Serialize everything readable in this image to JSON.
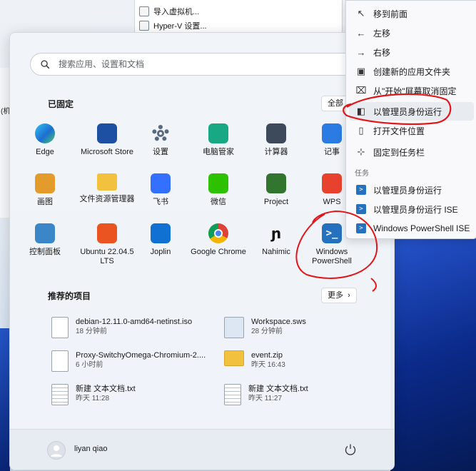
{
  "background": {
    "menu_items": [
      "导入虚拟机...",
      "Hyper-V 设置..."
    ],
    "left_edge_text": "(机"
  },
  "start": {
    "search_placeholder": "搜索应用、设置和文档",
    "pinned_title": "已固定",
    "all_label": "全部",
    "pinned": [
      {
        "label": "Edge",
        "icon": "edge-icon",
        "color": "#1f8ad6"
      },
      {
        "label": "Microsoft Store",
        "icon": "store-icon",
        "color": "#1d4fa3"
      },
      {
        "label": "设置",
        "icon": "gear-icon",
        "color": "#5a6a7e"
      },
      {
        "label": "电脑管家",
        "icon": "pc-manager-icon",
        "color": "#19a884"
      },
      {
        "label": "计算器",
        "icon": "calculator-icon",
        "color": "#3d4a5c"
      },
      {
        "label": "记事",
        "icon": "notepad-icon",
        "color": "#2a7be2"
      },
      {
        "label": "画图",
        "icon": "paint-icon",
        "color": "#e39c2b"
      },
      {
        "label": "文件资源管理器",
        "icon": "folder-icon",
        "color": "#f2c23e"
      },
      {
        "label": "飞书",
        "icon": "feishu-icon",
        "color": "#3370ff"
      },
      {
        "label": "微信",
        "icon": "wechat-icon",
        "color": "#2dc100"
      },
      {
        "label": "Project",
        "icon": "project-icon",
        "color": "#31752f"
      },
      {
        "label": "WPS",
        "icon": "wps-icon",
        "color": "#e8412e"
      },
      {
        "label": "控制面板",
        "icon": "control-panel-icon",
        "color": "#3b86c8"
      },
      {
        "label": "Ubuntu 22.04.5 LTS",
        "icon": "ubuntu-icon",
        "color": "#e95420"
      },
      {
        "label": "Joplin",
        "icon": "joplin-icon",
        "color": "#1071d3"
      },
      {
        "label": "Google Chrome",
        "icon": "chrome-icon",
        "color": "#db4437"
      },
      {
        "label": "Nahimic",
        "icon": "nahimic-icon",
        "color": "#1a1a1a"
      },
      {
        "label": "Windows PowerShell",
        "icon": "powershell-icon",
        "color": "#2671be"
      }
    ],
    "recommended_title": "推荐的项目",
    "more_label": "更多",
    "recommended": [
      {
        "name": "debian-12.11.0-amd64-netinst.iso",
        "time": "18 分钟前",
        "icon": "file-icon"
      },
      {
        "name": "Workspace.sws",
        "time": "28 分钟前",
        "icon": "workspace-icon"
      },
      {
        "name": "Proxy-SwitchyOmega-Chromium-2....",
        "time": "6 小时前",
        "icon": "file-icon"
      },
      {
        "name": "event.zip",
        "time": "昨天 16:43",
        "icon": "zip-folder-icon"
      },
      {
        "name": "新建 文本文档.txt",
        "time": "昨天 11:28",
        "icon": "text-file-icon"
      },
      {
        "name": "新建 文本文档.txt",
        "time": "昨天 11:27",
        "icon": "text-file-icon"
      }
    ],
    "user_name": "liyan qiao"
  },
  "context_menu": {
    "items": [
      {
        "label": "移到前面",
        "icon": "arrow-up-left-icon"
      },
      {
        "label": "左移",
        "icon": "arrow-left-icon"
      },
      {
        "label": "右移",
        "icon": "arrow-right-icon"
      },
      {
        "label": "创建新的应用文件夹",
        "icon": "new-folder-icon"
      },
      {
        "label": "从\"开始\"屏幕取消固定",
        "icon": "unpin-icon"
      },
      {
        "label": "以管理员身份运行",
        "icon": "shield-run-icon"
      },
      {
        "label": "打开文件位置",
        "icon": "open-file-location-icon"
      },
      {
        "label": "固定到任务栏",
        "icon": "pin-icon"
      }
    ],
    "tasks_header": "任务",
    "tasks": [
      {
        "label": "以管理员身份运行",
        "icon": "powershell-icon"
      },
      {
        "label": "以管理员身份运行 ISE",
        "icon": "powershell-icon"
      },
      {
        "label": "Windows PowerShell ISE",
        "icon": "powershell-icon"
      }
    ]
  }
}
